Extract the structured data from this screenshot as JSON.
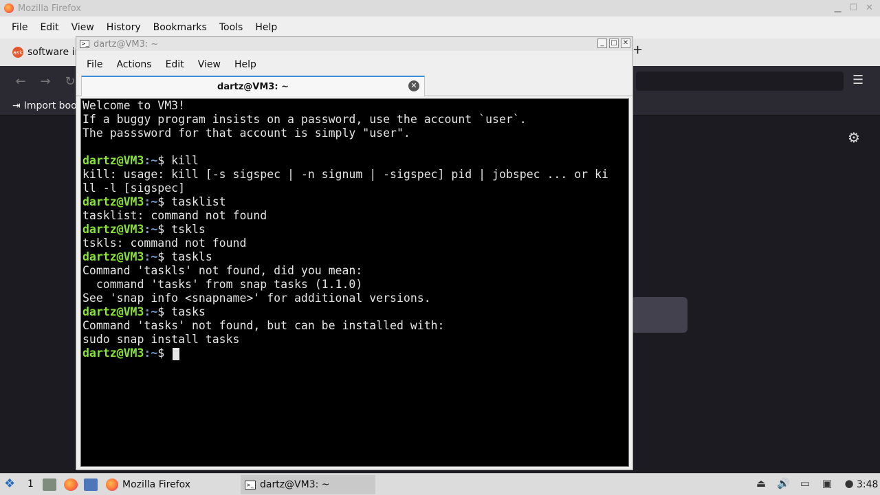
{
  "firefox": {
    "window_title": "Mozilla Firefox",
    "menu": [
      "File",
      "Edit",
      "View",
      "History",
      "Bookmarks",
      "Tools",
      "Help"
    ],
    "tab": {
      "icon_text": "ask",
      "label": "software in"
    },
    "bookmark": "Import boo"
  },
  "terminal": {
    "window_title": "dartz@VM3: ~",
    "menu": [
      "File",
      "Actions",
      "Edit",
      "View",
      "Help"
    ],
    "tab_title": "dartz@VM3: ~",
    "prompt_user": "dartz@VM3",
    "prompt_path": ":~",
    "prompt_symbol": "$",
    "lines": [
      {
        "text": "Welcome to VM3!"
      },
      {
        "text": "If a buggy program insists on a password, use the account `user`."
      },
      {
        "text": "The passsword for that account is simply \"user\"."
      },
      {
        "text": ""
      },
      {
        "prompt": true,
        "cmd": " kill"
      },
      {
        "text": "kill: usage: kill [-s sigspec | -n signum | -sigspec] pid | jobspec ... or ki"
      },
      {
        "text": "ll -l [sigspec]"
      },
      {
        "prompt": true,
        "cmd": " tasklist"
      },
      {
        "text": "tasklist: command not found"
      },
      {
        "prompt": true,
        "cmd": " tskls"
      },
      {
        "text": "tskls: command not found"
      },
      {
        "prompt": true,
        "cmd": " taskls"
      },
      {
        "text": "Command 'taskls' not found, did you mean:"
      },
      {
        "text": "  command 'tasks' from snap tasks (1.1.0)"
      },
      {
        "text": "See 'snap info <snapname>' for additional versions."
      },
      {
        "prompt": true,
        "cmd": " tasks"
      },
      {
        "text": "Command 'tasks' not found, but can be installed with:"
      },
      {
        "text": "sudo snap install tasks"
      },
      {
        "prompt": true,
        "cmd": " ",
        "cursor": true
      }
    ]
  },
  "taskbar": {
    "desktop_number": "1",
    "tasks": [
      {
        "label": "Mozilla Firefox",
        "active": false
      },
      {
        "label": "dartz@VM3: ~",
        "active": true
      }
    ],
    "clock": "3:48"
  }
}
